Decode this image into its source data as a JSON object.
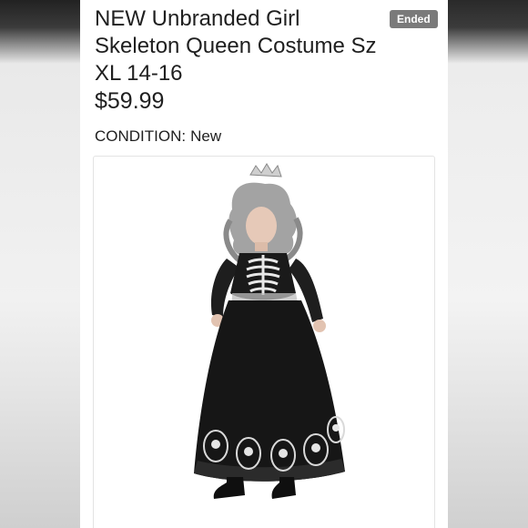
{
  "listing": {
    "title": "NEW Unbranded Girl Skeleton Queen Costume Sz XL 14-16",
    "price": "$59.99",
    "status": "Ended",
    "condition_label": "CONDITION:",
    "condition_value": "New"
  },
  "colors": {
    "status_badge": "#7a7a7a",
    "text": "#1f1f1f"
  }
}
